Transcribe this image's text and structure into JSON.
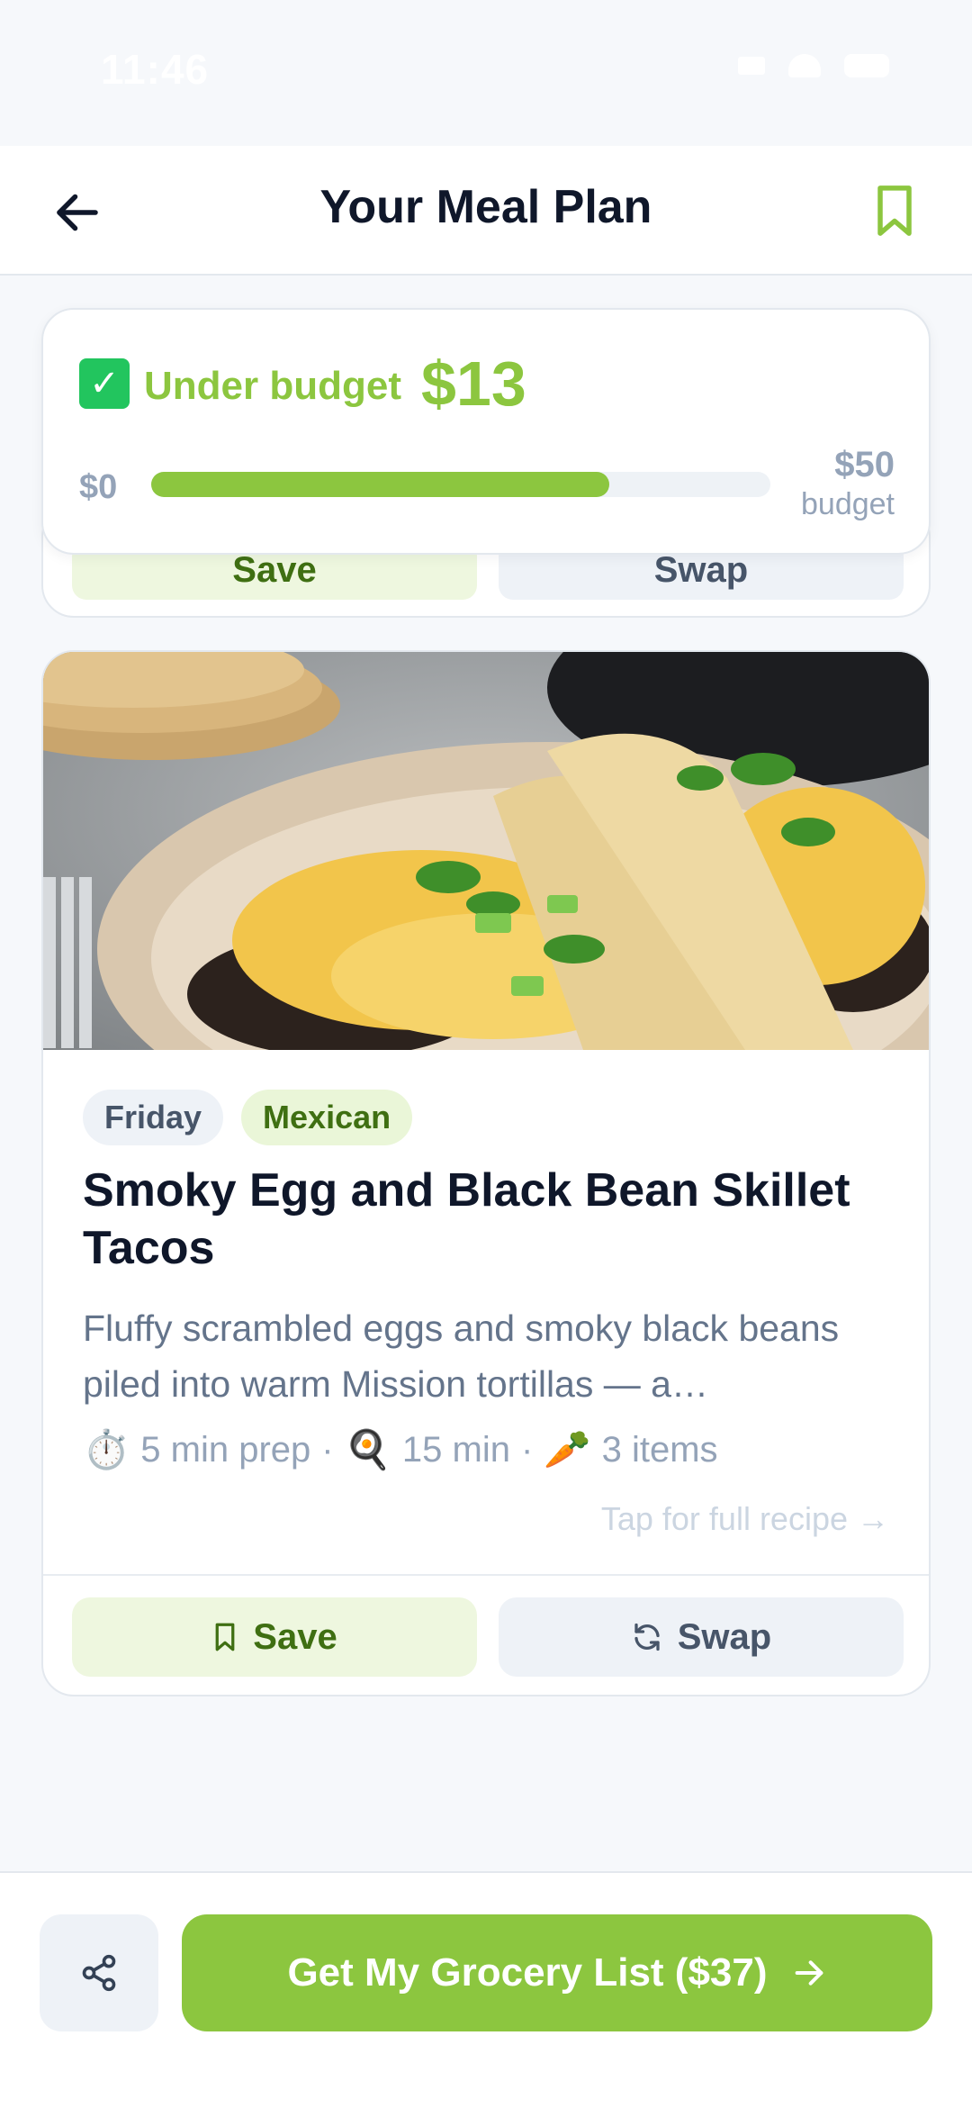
{
  "status_bar": {
    "time": "11:46"
  },
  "header": {
    "title": "Your Meal Plan",
    "back_icon": "arrow-left-icon",
    "bookmark_icon": "bookmark-icon"
  },
  "budget": {
    "status_label": "Under budget",
    "under_amount": "$13",
    "min_label": "$0",
    "max_amount": "$50",
    "max_label": "budget",
    "progress_fraction": 0.74,
    "accent_color": "#8cc63f"
  },
  "previous_card": {
    "save_label": "Save",
    "swap_label": "Swap"
  },
  "meal_card": {
    "day_tag": "Friday",
    "cuisine_tag": "Mexican",
    "title": "Smoky Egg and Black Bean Skillet Tacos",
    "description": "Fluffy scrambled eggs and smoky black beans piled into warm Mission tortillas — a…",
    "prep_emoji": "⏱️",
    "prep_text": "5 min prep",
    "cook_emoji": "🍳",
    "cook_text": "15 min",
    "items_emoji": "🥕",
    "items_text": "3 items",
    "tap_link": "Tap for full recipe →",
    "save_label": "Save",
    "swap_label": "Swap"
  },
  "bottom_bar": {
    "share_icon": "share-icon",
    "grocery_label": "Get My Grocery List ($37)",
    "grocery_icon": "arrow-right-icon"
  }
}
